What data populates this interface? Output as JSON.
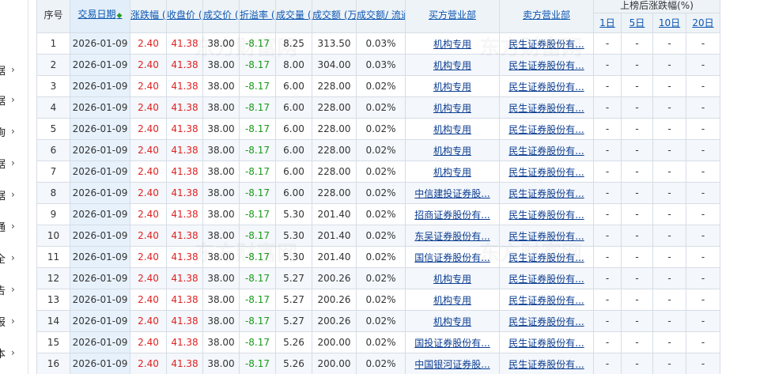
{
  "sidebar": {
    "items": [
      {
        "char": "据",
        "arrow": "›"
      },
      {
        "char": "据",
        "arrow": "›"
      },
      {
        "char": "询",
        "arrow": "›"
      },
      {
        "char": "据",
        "arrow": "›"
      },
      {
        "char": "据",
        "arrow": "›"
      },
      {
        "char": "通",
        "arrow": "›"
      },
      {
        "char": "全",
        "arrow": "›"
      },
      {
        "char": "告",
        "arrow": "›"
      },
      {
        "char": "报",
        "arrow": "›"
      },
      {
        "char": "本",
        "arrow": "›"
      }
    ]
  },
  "table": {
    "headers": {
      "index": "序号",
      "date": "交易日期",
      "sort_icon": "◆",
      "change_pct": "涨跌幅 (%)",
      "close": "收盘价 (元)",
      "price": "成交价 (元)",
      "premium": "折溢率 (%)",
      "volume": "成交量 (万股)",
      "amount": "成交额 (万元)",
      "float_ratio": "成交额/ 流通市值",
      "buyer": "买方营业部",
      "seller": "卖方营业部",
      "after": "上榜后涨跌幅(%)",
      "d1": "1日",
      "d5": "5日",
      "d10": "10日",
      "d20": "20日"
    },
    "rows": [
      {
        "idx": "1",
        "date": "2026-01-09",
        "chg": "2.40",
        "close": "41.38",
        "price": "38.00",
        "prem": "-8.17",
        "vol": "8.25",
        "amt": "313.50",
        "ratio": "0.03%",
        "buyer": "机构专用",
        "seller": "民生证券股份有...",
        "d1": "-",
        "d5": "-",
        "d10": "-",
        "d20": "-"
      },
      {
        "idx": "2",
        "date": "2026-01-09",
        "chg": "2.40",
        "close": "41.38",
        "price": "38.00",
        "prem": "-8.17",
        "vol": "8.00",
        "amt": "304.00",
        "ratio": "0.03%",
        "buyer": "机构专用",
        "seller": "民生证券股份有...",
        "d1": "-",
        "d5": "-",
        "d10": "-",
        "d20": "-"
      },
      {
        "idx": "3",
        "date": "2026-01-09",
        "chg": "2.40",
        "close": "41.38",
        "price": "38.00",
        "prem": "-8.17",
        "vol": "6.00",
        "amt": "228.00",
        "ratio": "0.02%",
        "buyer": "机构专用",
        "seller": "民生证券股份有...",
        "d1": "-",
        "d5": "-",
        "d10": "-",
        "d20": "-"
      },
      {
        "idx": "4",
        "date": "2026-01-09",
        "chg": "2.40",
        "close": "41.38",
        "price": "38.00",
        "prem": "-8.17",
        "vol": "6.00",
        "amt": "228.00",
        "ratio": "0.02%",
        "buyer": "机构专用",
        "seller": "民生证券股份有...",
        "d1": "-",
        "d5": "-",
        "d10": "-",
        "d20": "-"
      },
      {
        "idx": "5",
        "date": "2026-01-09",
        "chg": "2.40",
        "close": "41.38",
        "price": "38.00",
        "prem": "-8.17",
        "vol": "6.00",
        "amt": "228.00",
        "ratio": "0.02%",
        "buyer": "机构专用",
        "seller": "民生证券股份有...",
        "d1": "-",
        "d5": "-",
        "d10": "-",
        "d20": "-"
      },
      {
        "idx": "6",
        "date": "2026-01-09",
        "chg": "2.40",
        "close": "41.38",
        "price": "38.00",
        "prem": "-8.17",
        "vol": "6.00",
        "amt": "228.00",
        "ratio": "0.02%",
        "buyer": "机构专用",
        "seller": "民生证券股份有...",
        "d1": "-",
        "d5": "-",
        "d10": "-",
        "d20": "-"
      },
      {
        "idx": "7",
        "date": "2026-01-09",
        "chg": "2.40",
        "close": "41.38",
        "price": "38.00",
        "prem": "-8.17",
        "vol": "6.00",
        "amt": "228.00",
        "ratio": "0.02%",
        "buyer": "机构专用",
        "seller": "民生证券股份有...",
        "d1": "-",
        "d5": "-",
        "d10": "-",
        "d20": "-"
      },
      {
        "idx": "8",
        "date": "2026-01-09",
        "chg": "2.40",
        "close": "41.38",
        "price": "38.00",
        "prem": "-8.17",
        "vol": "6.00",
        "amt": "228.00",
        "ratio": "0.02%",
        "buyer": "中信建投证券股...",
        "seller": "民生证券股份有...",
        "d1": "-",
        "d5": "-",
        "d10": "-",
        "d20": "-"
      },
      {
        "idx": "9",
        "date": "2026-01-09",
        "chg": "2.40",
        "close": "41.38",
        "price": "38.00",
        "prem": "-8.17",
        "vol": "5.30",
        "amt": "201.40",
        "ratio": "0.02%",
        "buyer": "招商证券股份有...",
        "seller": "民生证券股份有...",
        "d1": "-",
        "d5": "-",
        "d10": "-",
        "d20": "-"
      },
      {
        "idx": "10",
        "date": "2026-01-09",
        "chg": "2.40",
        "close": "41.38",
        "price": "38.00",
        "prem": "-8.17",
        "vol": "5.30",
        "amt": "201.40",
        "ratio": "0.02%",
        "buyer": "东吴证券股份有...",
        "seller": "民生证券股份有...",
        "d1": "-",
        "d5": "-",
        "d10": "-",
        "d20": "-"
      },
      {
        "idx": "11",
        "date": "2026-01-09",
        "chg": "2.40",
        "close": "41.38",
        "price": "38.00",
        "prem": "-8.17",
        "vol": "5.30",
        "amt": "201.40",
        "ratio": "0.02%",
        "buyer": "国信证券股份有...",
        "seller": "民生证券股份有...",
        "d1": "-",
        "d5": "-",
        "d10": "-",
        "d20": "-"
      },
      {
        "idx": "12",
        "date": "2026-01-09",
        "chg": "2.40",
        "close": "41.38",
        "price": "38.00",
        "prem": "-8.17",
        "vol": "5.27",
        "amt": "200.26",
        "ratio": "0.02%",
        "buyer": "机构专用",
        "seller": "民生证券股份有...",
        "d1": "-",
        "d5": "-",
        "d10": "-",
        "d20": "-"
      },
      {
        "idx": "13",
        "date": "2026-01-09",
        "chg": "2.40",
        "close": "41.38",
        "price": "38.00",
        "prem": "-8.17",
        "vol": "5.27",
        "amt": "200.26",
        "ratio": "0.02%",
        "buyer": "机构专用",
        "seller": "民生证券股份有...",
        "d1": "-",
        "d5": "-",
        "d10": "-",
        "d20": "-"
      },
      {
        "idx": "14",
        "date": "2026-01-09",
        "chg": "2.40",
        "close": "41.38",
        "price": "38.00",
        "prem": "-8.17",
        "vol": "5.27",
        "amt": "200.26",
        "ratio": "0.02%",
        "buyer": "机构专用",
        "seller": "民生证券股份有...",
        "d1": "-",
        "d5": "-",
        "d10": "-",
        "d20": "-"
      },
      {
        "idx": "15",
        "date": "2026-01-09",
        "chg": "2.40",
        "close": "41.38",
        "price": "38.00",
        "prem": "-8.17",
        "vol": "5.26",
        "amt": "200.00",
        "ratio": "0.02%",
        "buyer": "国投证券股份有...",
        "seller": "民生证券股份有...",
        "d1": "-",
        "d5": "-",
        "d10": "-",
        "d20": "-"
      },
      {
        "idx": "16",
        "date": "2026-01-09",
        "chg": "2.40",
        "close": "41.38",
        "price": "38.00",
        "prem": "-8.17",
        "vol": "5.26",
        "amt": "200.00",
        "ratio": "0.02%",
        "buyer": "中国银河证券股...",
        "seller": "民生证券股份有...",
        "d1": "-",
        "d5": "-",
        "d10": "-",
        "d20": "-"
      }
    ]
  },
  "colors": {
    "up": "#e02222",
    "down": "#199a19",
    "link": "#0b56b0",
    "header_bg": "#eef3f8",
    "date_col_bg": "#e6f1fb"
  }
}
